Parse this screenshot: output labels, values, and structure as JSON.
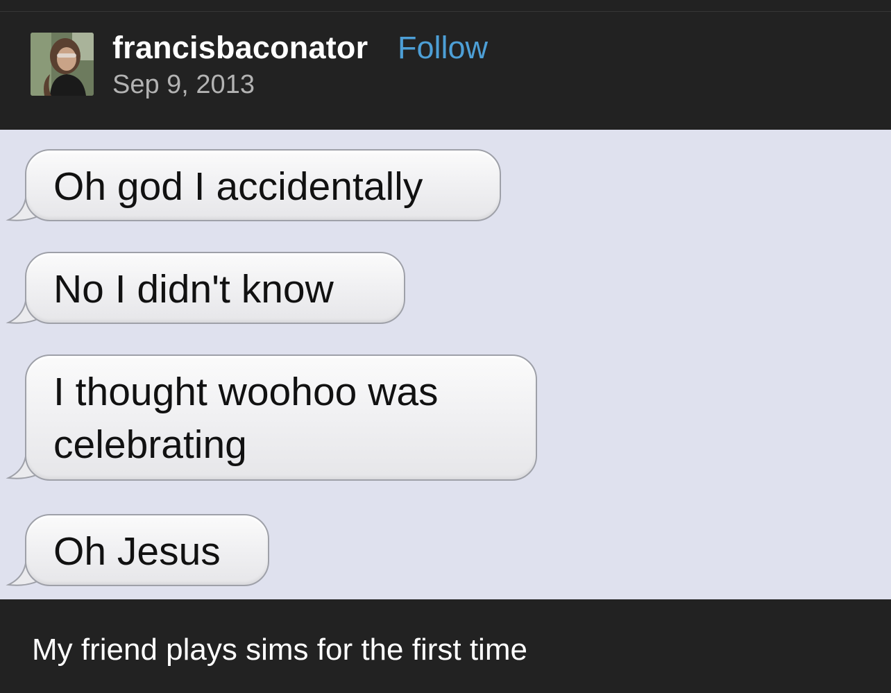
{
  "post": {
    "username": "francisbaconator",
    "follow_label": "Follow",
    "date": "Sep 9, 2013"
  },
  "messages": [
    {
      "lines": [
        "Oh god I accidentally"
      ]
    },
    {
      "lines": [
        "No I didn't know"
      ]
    },
    {
      "lines": [
        "I thought woohoo was",
        "celebrating"
      ]
    },
    {
      "lines": [
        "Oh Jesus"
      ]
    }
  ],
  "caption": "My friend plays sims for the first time",
  "colors": {
    "background": "#222222",
    "message_area": "#dfe1ee",
    "follow": "#4d9fd6",
    "date": "#b3b3b3"
  }
}
